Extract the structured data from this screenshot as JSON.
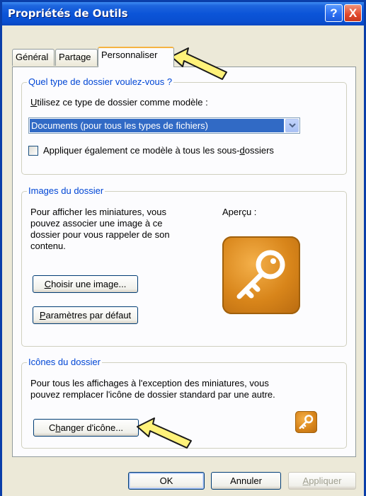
{
  "window": {
    "title": "Propriétés de Outils",
    "help_label": "?",
    "close_label": "X"
  },
  "tabs": [
    {
      "label": "Général",
      "active": false
    },
    {
      "label": "Partage",
      "active": false
    },
    {
      "label": "Personnaliser",
      "active": true
    }
  ],
  "folder_type": {
    "legend": "Quel type de dossier voulez-vous ?",
    "label_prefix": "U",
    "label_rest": "tilisez ce type de dossier comme modèle :",
    "selected": "Documents (pour tous les types de fichiers)",
    "apply_sub_pre": "Appliquer également ce modèle à tous les sous-",
    "apply_sub_key": "d",
    "apply_sub_post": "ossiers",
    "apply_sub_checked": false
  },
  "folder_images": {
    "legend": "Images du dossier",
    "description_lines": [
      "Pour afficher les miniatures, vous",
      "pouvez associer une image à ce",
      "dossier pour vous rappeler de son",
      "contenu."
    ],
    "preview_label": "Aperçu :",
    "choose_key": "C",
    "choose_rest": "hoisir une image...",
    "default_key": "P",
    "default_rest": "aramètres par défaut"
  },
  "folder_icons": {
    "legend": "Icônes du dossier",
    "description_lines": [
      "Pour tous les affichages à l'exception des miniatures, vous",
      "pouvez remplacer l'icône de dossier standard par une autre."
    ],
    "change_pre": "C",
    "change_key": "h",
    "change_rest": "anger d'icône..."
  },
  "footer": {
    "ok_label": "OK",
    "cancel_label": "Annuler",
    "apply_key": "A",
    "apply_rest": "ppliquer"
  },
  "colors": {
    "titlebar": "#0b54d8",
    "legend_text": "#0046d5",
    "selection": "#316ac5",
    "icon_orange": "#d8851a",
    "arrow_yellow": "#fff27a"
  },
  "icons": [
    "help-icon",
    "close-icon",
    "dropdown-arrow-icon",
    "key-icon",
    "pointer-arrow-icon"
  ]
}
